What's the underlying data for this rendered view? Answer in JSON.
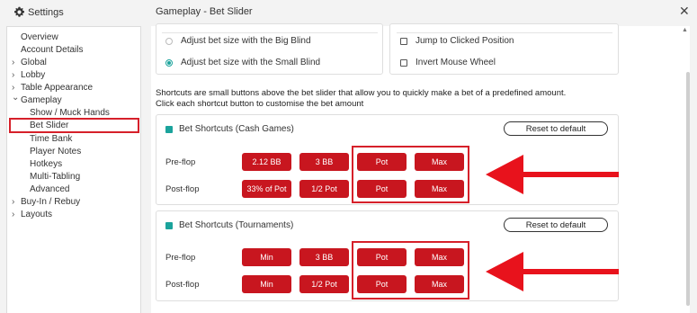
{
  "window": {
    "app_title": "Settings",
    "page_title": "Gameplay - Bet Slider",
    "close_glyph": "✕"
  },
  "sidebar": {
    "items": [
      {
        "label": "Overview"
      },
      {
        "label": "Account Details"
      },
      {
        "label": "Global",
        "chevron": "›"
      },
      {
        "label": "Lobby",
        "chevron": "›"
      },
      {
        "label": "Table Appearance",
        "chevron": "›"
      },
      {
        "label": "Gameplay",
        "chevron": "⌄"
      },
      {
        "label": "Show / Muck Hands"
      },
      {
        "label": "Bet Slider",
        "selected": true
      },
      {
        "label": "Time Bank"
      },
      {
        "label": "Player Notes"
      },
      {
        "label": "Hotkeys"
      },
      {
        "label": "Multi-Tabling"
      },
      {
        "label": "Advanced"
      },
      {
        "label": "Buy-In / Rebuy",
        "chevron": "›"
      },
      {
        "label": "Layouts",
        "chevron": "›"
      }
    ]
  },
  "slider_options": {
    "big_blind_label": "Adjust bet size with the Big Blind",
    "big_blind_selected": false,
    "small_blind_label": "Adjust bet size with the Small Blind",
    "small_blind_selected": true,
    "jump_label": "Jump to Clicked Position",
    "jump_checked": false,
    "invert_label": "Invert Mouse Wheel",
    "invert_checked": false
  },
  "description": {
    "line1": "Shortcuts are small buttons above the bet slider that allow you to quickly make a bet of a predefined amount.",
    "line2": "Click each shortcut button to customise the bet amount"
  },
  "cash": {
    "title": "Bet Shortcuts (Cash Games)",
    "enabled": true,
    "reset_label": "Reset to default",
    "preflop_label": "Pre-flop",
    "postflop_label": "Post-flop",
    "preflop": [
      "2.12 BB",
      "3 BB",
      "Pot",
      "Max"
    ],
    "postflop": [
      "33% of Pot",
      "1/2 Pot",
      "Pot",
      "Max"
    ]
  },
  "tournaments": {
    "title": "Bet Shortcuts (Tournaments)",
    "enabled": true,
    "reset_label": "Reset to default",
    "preflop_label": "Pre-flop",
    "postflop_label": "Post-flop",
    "preflop": [
      "Min",
      "3 BB",
      "Pot",
      "Max"
    ],
    "postflop": [
      "Min",
      "1/2 Pot",
      "Pot",
      "Max"
    ]
  },
  "colors": {
    "accent": "#1ba39c",
    "button_red": "#c8161f",
    "annotation_red": "#d6202a"
  }
}
